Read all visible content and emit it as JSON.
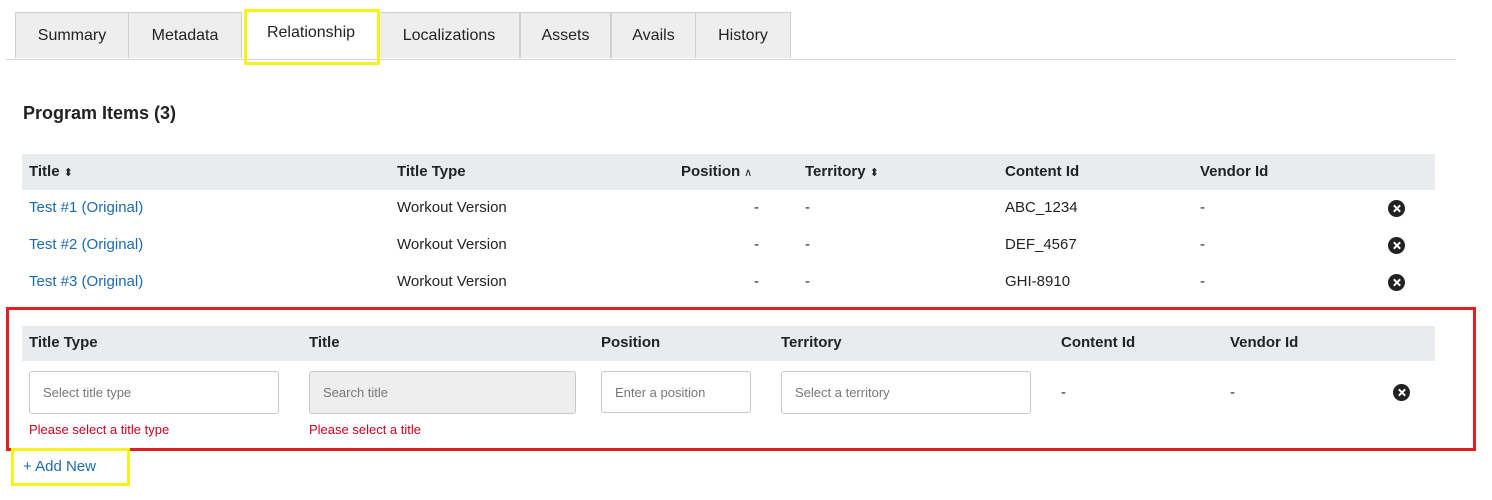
{
  "tabs": [
    {
      "label": "Summary",
      "active": false
    },
    {
      "label": "Metadata",
      "active": false
    },
    {
      "label": "Relationship",
      "active": true
    },
    {
      "label": "Localizations",
      "active": false
    },
    {
      "label": "Assets",
      "active": false
    },
    {
      "label": "Avails",
      "active": false
    },
    {
      "label": "History",
      "active": false
    }
  ],
  "section": {
    "title": "Program Items (3)"
  },
  "items_table": {
    "headers": {
      "title": "Title",
      "title_type": "Title Type",
      "position": "Position",
      "territory": "Territory",
      "content_id": "Content Id",
      "vendor_id": "Vendor Id"
    },
    "rows": [
      {
        "title": "Test #1 (Original)",
        "title_type": "Workout Version",
        "position": "-",
        "territory": "-",
        "content_id": "ABC_1234",
        "vendor_id": "-"
      },
      {
        "title": "Test #2 (Original)",
        "title_type": "Workout Version",
        "position": "-",
        "territory": "-",
        "content_id": "DEF_4567",
        "vendor_id": "-"
      },
      {
        "title": "Test #3 (Original)",
        "title_type": "Workout Version",
        "position": "-",
        "territory": "-",
        "content_id": "GHI-8910",
        "vendor_id": "-"
      }
    ]
  },
  "new_item": {
    "headers": {
      "title_type": "Title Type",
      "title": "Title",
      "position": "Position",
      "territory": "Territory",
      "content_id": "Content Id",
      "vendor_id": "Vendor Id"
    },
    "title_type_placeholder": "Select title type",
    "title_placeholder": "Search title",
    "position_placeholder": "Enter a position",
    "territory_placeholder": "Select a territory",
    "content_id": "-",
    "vendor_id": "-",
    "title_type_error": "Please select a title type",
    "title_error": "Please select a title"
  },
  "add_new_label": "+ Add New",
  "colors": {
    "link": "#1a6bb5",
    "error": "#d0021b",
    "highlight_yellow": "#f5f31b",
    "highlight_red": "#e02020"
  }
}
